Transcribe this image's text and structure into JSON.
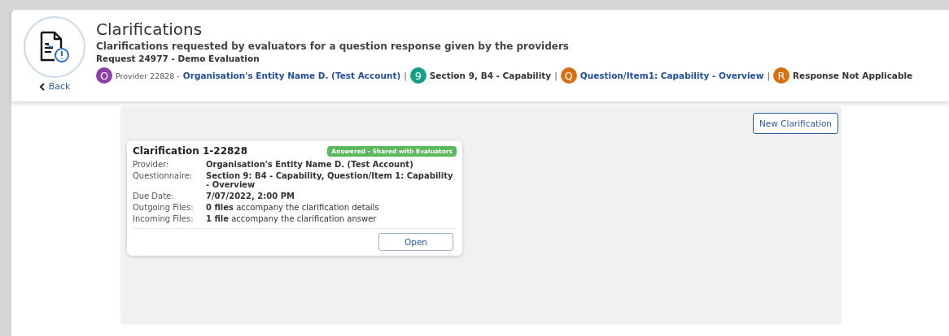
{
  "header": {
    "title": "Clarifications",
    "subtitle": "Clarifications requested by evaluators for a question response given by the providers",
    "request": "Request 24977 - Demo Evaluation",
    "back": "Back"
  },
  "breadcrumb": [
    {
      "kind": "link",
      "badge": "O",
      "color": "#8a3ea6",
      "prefix": "Provider 22828 -",
      "text": "Organisation's Entity Name D. (Test Account)"
    },
    {
      "kind": "text",
      "separator": "|",
      "badge": "9",
      "color": "#14a085",
      "text": "Section 9, B4 - Capability"
    },
    {
      "kind": "link",
      "separator": "|",
      "badge": "Q",
      "color": "#d9700f",
      "text": "Question/Item1: Capability - Overview"
    },
    {
      "kind": "text",
      "separator": "|",
      "badge": "R",
      "color": "#d9700f",
      "text": "Response Not Applicable"
    }
  ],
  "new_button": "New Clarification",
  "card": {
    "title": "Clarification 1-22828",
    "status": "Answered - Shared with Evaluators",
    "fields": [
      {
        "label": "Provider:",
        "value": "Organisation's Entity Name D. (Test Account)",
        "bold": true
      },
      {
        "label": "Questionnaire:",
        "value": "Section 9: B4 - Capability, Question/Item 1: Capability - Overview",
        "bold": true
      },
      {
        "label": "Due Date:",
        "value": "7/07/2022, 2:00 PM",
        "bold": true
      },
      {
        "label": "Outgoing Files:",
        "value": "**0 files** accompany the clarification details",
        "bold": false
      },
      {
        "label": "Incoming Files:",
        "value": "**1 file** accompany the clarification answer",
        "bold": false
      }
    ],
    "open_button": "Open"
  }
}
